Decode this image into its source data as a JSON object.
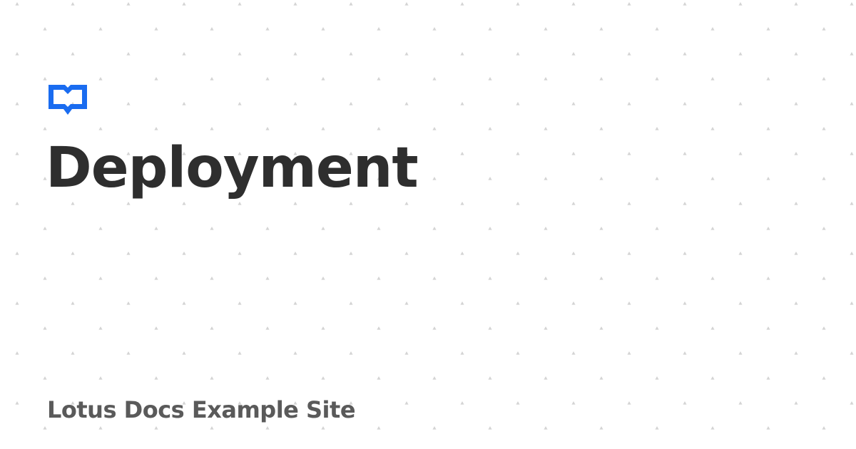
{
  "page": {
    "title": "Deployment",
    "site_name": "Lotus Docs Example Site"
  },
  "logo": {
    "icon": "open-book-icon",
    "color": "#1a6cf0"
  },
  "colors": {
    "background": "#ffffff",
    "title": "#2e2e2e",
    "site_name": "#5a5a5a",
    "pattern_dots": "#d4d4d4"
  }
}
